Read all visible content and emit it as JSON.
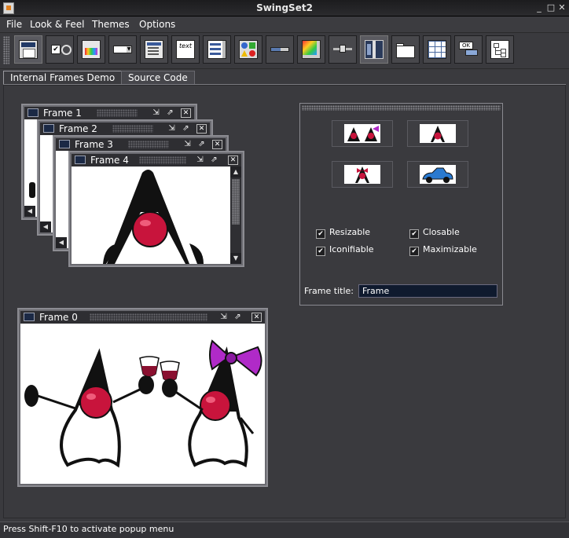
{
  "window": {
    "title": "SwingSet2",
    "minimize": "_",
    "maximize": "□",
    "close": "✕"
  },
  "menubar": {
    "items": [
      "File",
      "Look & Feel",
      "Themes",
      "Options"
    ]
  },
  "toolbar": {
    "items": [
      "internal-frames-demo-icon",
      "buttons-demo-icon",
      "color-chooser-demo-icon",
      "combobox-demo-icon",
      "file-chooser-demo-icon",
      "html-demo-icon",
      "list-demo-icon",
      "option-pane-demo-icon",
      "progress-bar-demo-icon",
      "scroll-pane-demo-icon",
      "slider-demo-icon",
      "split-pane-demo-icon",
      "tabbed-pane-demo-icon",
      "table-demo-icon",
      "tooltip-demo-icon",
      "tree-demo-icon"
    ],
    "html_icon_text": "text",
    "ok_icon_text": "OK"
  },
  "tabs": [
    {
      "label": "Internal Frames Demo",
      "active": true
    },
    {
      "label": "Source Code",
      "active": false
    }
  ],
  "frames": [
    {
      "title": "Frame 1"
    },
    {
      "title": "Frame 2"
    },
    {
      "title": "Frame 3"
    },
    {
      "title": "Frame 4"
    },
    {
      "title": "Frame 0"
    }
  ],
  "frame_buttons": {
    "iconify": "⇲",
    "maximize": "⇗",
    "close": "✕"
  },
  "scrollbar": {
    "up": "▲",
    "down": "▼",
    "left": "◀"
  },
  "panel": {
    "image_buttons": [
      "duke-toasting-icon",
      "duke-single-icon",
      "duke-bowtie-icon",
      "duke-car-icon"
    ],
    "checkboxes": [
      {
        "label": "Resizable",
        "checked": true
      },
      {
        "label": "Closable",
        "checked": true
      },
      {
        "label": "Iconifiable",
        "checked": true
      },
      {
        "label": "Maximizable",
        "checked": true
      }
    ],
    "check_mark": "✔",
    "frame_title_label": "Frame title:",
    "frame_title_value": "Frame"
  },
  "status": {
    "text": "Press Shift-F10 to activate popup menu"
  }
}
